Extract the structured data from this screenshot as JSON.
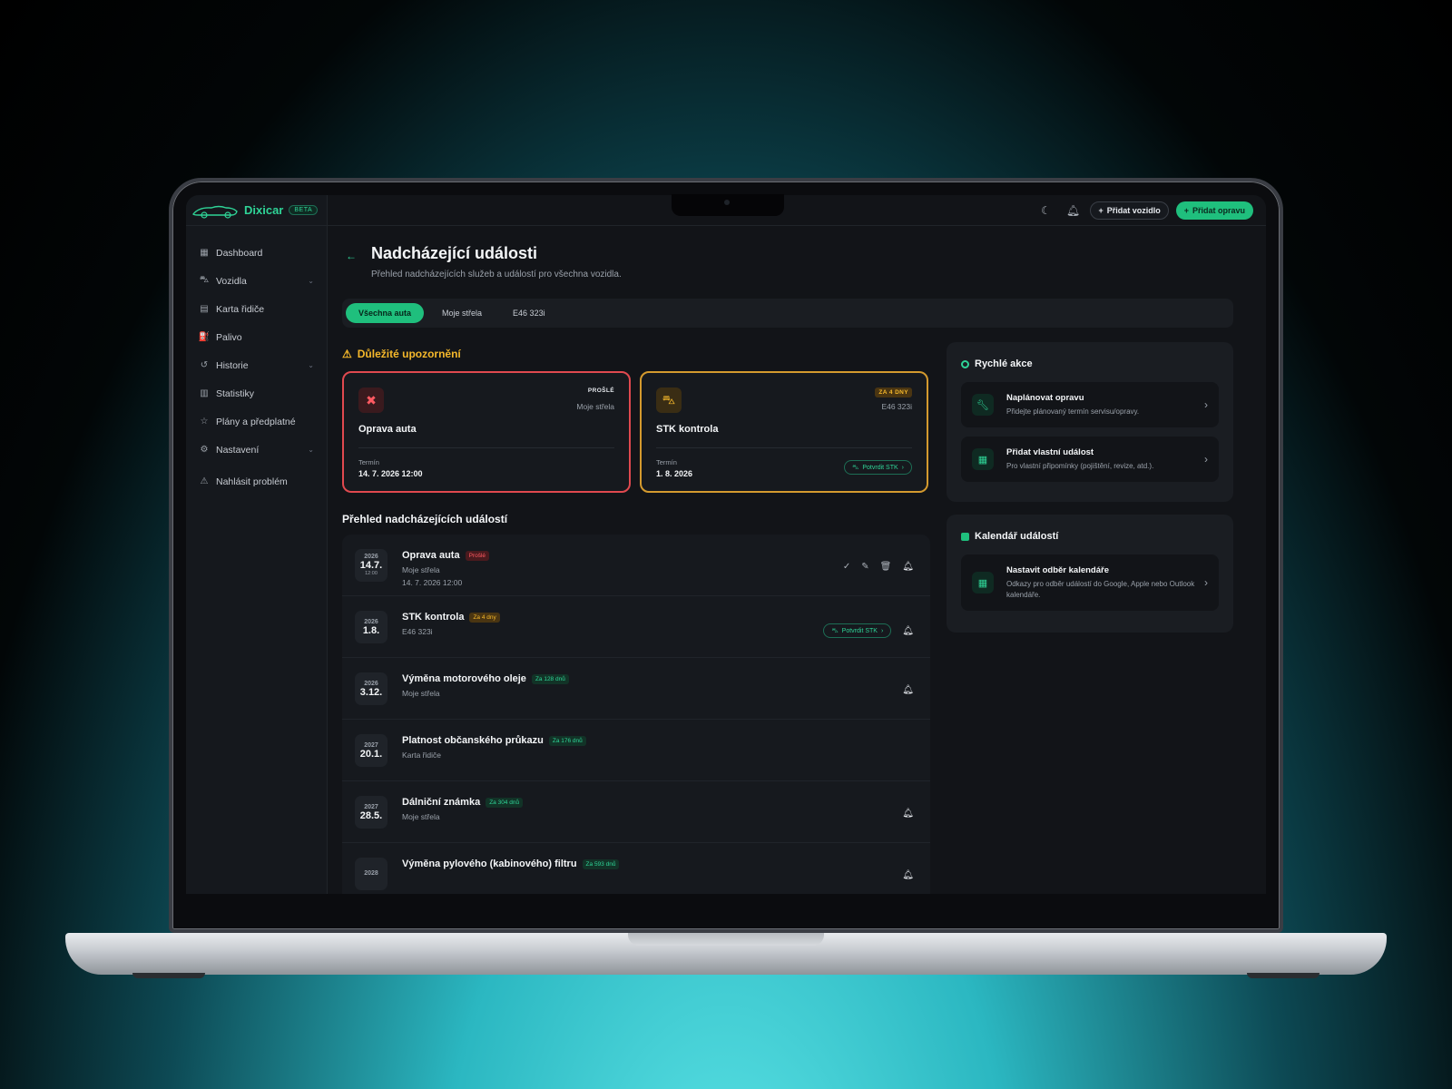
{
  "app": {
    "name": "Dixicar",
    "badge": "BETA"
  },
  "sidebar": {
    "items": [
      {
        "label": "Dashboard",
        "icon": "grid-icon"
      },
      {
        "label": "Vozidla",
        "icon": "car-icon",
        "expandable": true
      },
      {
        "label": "Karta řidiče",
        "icon": "id-card-icon"
      },
      {
        "label": "Palivo",
        "icon": "fuel-icon"
      },
      {
        "label": "Historie",
        "icon": "history-icon",
        "expandable": true
      },
      {
        "label": "Statistiky",
        "icon": "chart-icon"
      },
      {
        "label": "Plány a předplatné",
        "icon": "star-icon"
      },
      {
        "label": "Nastavení",
        "icon": "gear-icon",
        "expandable": true
      },
      {
        "label": "Nahlásit problém",
        "icon": "warning-icon"
      }
    ]
  },
  "topbar": {
    "add_vehicle": "Přidat vozidlo",
    "add_repair": "Přidat opravu"
  },
  "page": {
    "title": "Nadcházející události",
    "subtitle": "Přehled nadcházejících služeb a událostí pro všechna vozidla."
  },
  "tabs": [
    "Všechna auta",
    "Moje střela",
    "E46 323i"
  ],
  "warnings": {
    "title": "Důležité upozornění",
    "cards": [
      {
        "badge": "PROŠLÉ",
        "car": "Moje střela",
        "name": "Oprava auta",
        "term_label": "Termín",
        "date": "14. 7. 2026 12:00"
      },
      {
        "badge": "ZA 4 DNY",
        "car": "E46 323i",
        "name": "STK kontrola",
        "term_label": "Termín",
        "date": "1. 8. 2026",
        "action": "Potvrdit STK"
      }
    ]
  },
  "events": {
    "title": "Přehled nadcházejících událostí",
    "rows": [
      {
        "year": "2026",
        "day": "14.7.",
        "time": "12:00",
        "title": "Oprava auta",
        "badge": "Prošlé",
        "sub": "Moje střela",
        "datetime": "14. 7. 2026 12:00"
      },
      {
        "year": "2026",
        "day": "1.8.",
        "title": "STK kontrola",
        "badge": "Za 4 dny",
        "sub": "E46 323i",
        "action": "Potvrdit STK"
      },
      {
        "year": "2026",
        "day": "3.12.",
        "title": "Výměna motorového oleje",
        "badge": "Za 128 dnů",
        "sub": "Moje střela"
      },
      {
        "year": "2027",
        "day": "20.1.",
        "title": "Platnost občanského průkazu",
        "badge": "Za 176 dnů",
        "sub": "Karta řidiče"
      },
      {
        "year": "2027",
        "day": "28.5.",
        "title": "Dálniční známka",
        "badge": "Za 304 dnů",
        "sub": "Moje střela"
      },
      {
        "year": "2028",
        "day": "",
        "title": "Výměna pylového (kabinového) filtru",
        "badge": "Za 593 dnů",
        "sub": ""
      }
    ]
  },
  "quick_actions": {
    "title": "Rychlé akce",
    "items": [
      {
        "title": "Naplánovat opravu",
        "desc": "Přidejte plánovaný termín servisu/opravy."
      },
      {
        "title": "Přidat vlastní událost",
        "desc": "Pro vlastní připomínky (pojištění, revize, atd.)."
      }
    ]
  },
  "calendar": {
    "title": "Kalendář událostí",
    "item": {
      "title": "Nastavit odběr kalendáře",
      "desc": "Odkazy pro odběr událostí do Google, Apple nebo Outlook kalendáře."
    }
  },
  "colors": {
    "accent": "#1fbf7d",
    "danger": "#e0494f",
    "warning": "#f5b82b",
    "bg": "#121418"
  }
}
